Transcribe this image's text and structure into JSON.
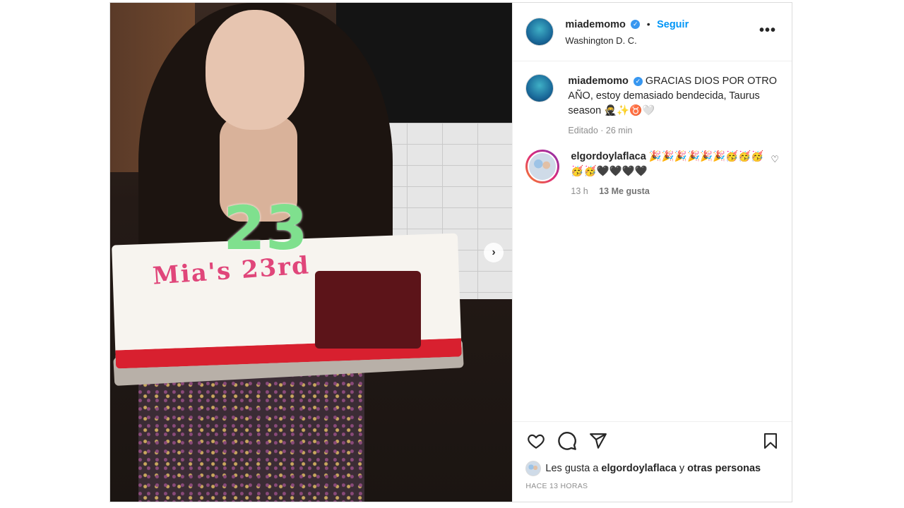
{
  "post": {
    "author": {
      "username": "miademomo",
      "verified": true,
      "location": "Washington D. C.",
      "follow_label": "Seguir",
      "separator": "•",
      "more_label": "•••"
    },
    "image": {
      "candle_text": "23",
      "cake_text": "Mia's 23rd",
      "next_label": "›"
    },
    "caption": {
      "username": "miademomo",
      "text": "GRACIAS DIOS POR OTRO AÑO, estoy demasiado bendecida, Taurus season 🥷✨♉🤍",
      "meta": "Editado · 26 min"
    },
    "comments": [
      {
        "username": "elgordoylaflaca",
        "text": "🎉🎉🎉🎉🎉🎉🥳🥳🥳🥳🥳🖤🖤🖤🖤",
        "time": "13 h",
        "likes": "13 Me gusta"
      }
    ],
    "actions": {
      "like_icon": "heart-icon",
      "comment_icon": "comment-icon",
      "share_icon": "send-icon",
      "save_icon": "bookmark-icon"
    },
    "likes_line": {
      "prefix": "Les gusta a",
      "user": "elgordoylaflaca",
      "connector": "y",
      "others": "otras personas"
    },
    "time_ago": "HACE 13 HORAS"
  },
  "colors": {
    "link_blue": "#0095f6",
    "verified_blue": "#3897f0",
    "muted_gray": "#8e8e8e",
    "border": "#dbdbdb"
  }
}
